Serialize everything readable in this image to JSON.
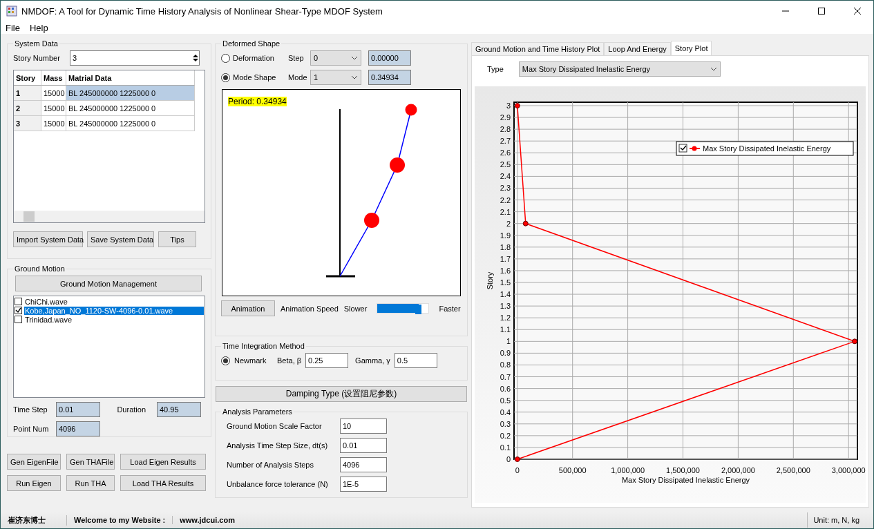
{
  "window": {
    "title": "NMDOF: A Tool for Dynamic Time History Analysis of Nonlinear Shear-Type MDOF System"
  },
  "menu": [
    "File",
    "Help"
  ],
  "system_data": {
    "title": "System Data",
    "story_number_label": "Story Number",
    "story_number": "3",
    "table": {
      "columns": [
        "Story",
        "Mass",
        "Matrial Data"
      ],
      "rows": [
        {
          "cells": [
            "1",
            "15000",
            "BL 245000000 1225000 0"
          ],
          "selected": true
        },
        {
          "cells": [
            "2",
            "15000",
            "BL 245000000 1225000 0"
          ],
          "selected": false
        },
        {
          "cells": [
            "3",
            "15000",
            "BL 245000000 1225000 0"
          ],
          "selected": false
        }
      ]
    },
    "buttons": [
      "Import System Data",
      "Save System Data",
      "Tips"
    ]
  },
  "ground_motion": {
    "title": "Ground Motion",
    "manage_button": "Ground Motion Management",
    "items": [
      {
        "label": "ChiChi.wave",
        "checked": false,
        "selected": false
      },
      {
        "label": "Kobe,Japan_NO_1120-SW-4096-0.01.wave",
        "checked": true,
        "selected": true
      },
      {
        "label": "Trinidad.wave",
        "checked": false,
        "selected": false
      }
    ],
    "time_step_label": "Time Step",
    "time_step": "0.01",
    "duration_label": "Duration",
    "duration": "40.95",
    "point_num_label": "Point Num",
    "point_num": "4096"
  },
  "action_buttons": [
    [
      "Gen EigenFile",
      "Gen THAFile",
      "Load Eigen Results"
    ],
    [
      "Run Eigen",
      "Run THA",
      "Load THA Results"
    ]
  ],
  "deformed_shape": {
    "title": "Deformed Shape",
    "options": [
      {
        "label": "Deformation",
        "selected": false,
        "select_label": "Step",
        "select_value": "0",
        "readout": "0.00000"
      },
      {
        "label": "Mode Shape",
        "selected": true,
        "select_label": "Mode",
        "select_value": "1",
        "readout": "0.34934"
      }
    ],
    "period_label": "Period: 0.34934",
    "animation_button": "Animation",
    "speed_label": "Animation Speed",
    "slower": "Slower",
    "faster": "Faster",
    "speed": {
      "level": 0.8
    }
  },
  "time_integration": {
    "title": "Time Integration Method",
    "method": {
      "label": "Newmark",
      "selected": true
    },
    "beta_label": "Beta, β",
    "beta": "0.25",
    "gamma_label": "Gamma, γ",
    "gamma": "0.5"
  },
  "damping_button": "Damping Type (设置阻尼参数)",
  "analysis_parameters": {
    "title": "Analysis Parameters",
    "fields": [
      {
        "label": "Ground Motion Scale Factor",
        "value": "10"
      },
      {
        "label": "Analysis Time Step Size, dt(s)",
        "value": "0.01"
      },
      {
        "label": "Number of Analysis Steps",
        "value": "4096"
      },
      {
        "label": "Unbalance force tolerance (N)",
        "value": "1E-5"
      }
    ]
  },
  "tabs": [
    {
      "label": "Ground Motion and Time History Plot",
      "selected": false
    },
    {
      "label": "Loop And Energy",
      "selected": false
    },
    {
      "label": "Story Plot",
      "selected": true
    }
  ],
  "story_plot": {
    "type_label": "Type",
    "type_value": "Max Story Dissipated Inelastic Energy",
    "chart_data": {
      "type": "line",
      "orientation": "horizontal",
      "grid": true,
      "xlabel": "Max Story Dissipated Inelastic Energy",
      "ylabel": "Story",
      "x": [
        0,
        1,
        2,
        3
      ],
      "series": [
        {
          "name": "Max Story Dissipated Inelastic Energy",
          "color": "#ff0000",
          "marker": "circle",
          "values": [
            0,
            3055000,
            75000,
            0
          ]
        }
      ],
      "xlim": [
        -30000,
        3080000
      ],
      "ylim": [
        0,
        3
      ],
      "xticks": [
        {
          "value": 0,
          "label": "0"
        },
        {
          "value": 500000,
          "label": "500,000"
        },
        {
          "value": 1000000,
          "label": "1,000,000"
        },
        {
          "value": 1500000,
          "label": "1,500,000"
        },
        {
          "value": 2000000,
          "label": "2,000,000"
        },
        {
          "value": 2500000,
          "label": "2,500,000"
        },
        {
          "value": 3000000,
          "label": "3,000,000"
        }
      ],
      "yticks": [
        {
          "value": 0,
          "label": "0"
        },
        {
          "value": 0.1,
          "label": "0.1"
        },
        {
          "value": 0.2,
          "label": "0.2"
        },
        {
          "value": 0.3,
          "label": "0.3"
        },
        {
          "value": 0.4,
          "label": "0.4"
        },
        {
          "value": 0.5,
          "label": "0.5"
        },
        {
          "value": 0.6,
          "label": "0.6"
        },
        {
          "value": 0.7,
          "label": "0.7"
        },
        {
          "value": 0.8,
          "label": "0.8"
        },
        {
          "value": 0.9,
          "label": "0.9"
        },
        {
          "value": 1,
          "label": "1"
        },
        {
          "value": 1.1,
          "label": "1.1"
        },
        {
          "value": 1.2,
          "label": "1.2"
        },
        {
          "value": 1.3,
          "label": "1.3"
        },
        {
          "value": 1.4,
          "label": "1.4"
        },
        {
          "value": 1.5,
          "label": "1.5"
        },
        {
          "value": 1.6,
          "label": "1.6"
        },
        {
          "value": 1.7,
          "label": "1.7"
        },
        {
          "value": 1.8,
          "label": "1.8"
        },
        {
          "value": 1.9,
          "label": "1.9"
        },
        {
          "value": 2,
          "label": "2"
        },
        {
          "value": 2.1,
          "label": "2.1"
        },
        {
          "value": 2.2,
          "label": "2.2"
        },
        {
          "value": 2.3,
          "label": "2.3"
        },
        {
          "value": 2.4,
          "label": "2.4"
        },
        {
          "value": 2.5,
          "label": "2.5"
        },
        {
          "value": 2.6,
          "label": "2.6"
        },
        {
          "value": 2.7,
          "label": "2.7"
        },
        {
          "value": 2.8,
          "label": "2.8"
        },
        {
          "value": 2.9,
          "label": "2.9"
        },
        {
          "value": 3,
          "label": "3"
        }
      ]
    },
    "legend_checked": true
  },
  "status_bar": {
    "author": "崔济东博士",
    "welcome": "Welcome to my Website :",
    "website": "www.jdcui.com",
    "units": "Unit: m, N, kg"
  }
}
